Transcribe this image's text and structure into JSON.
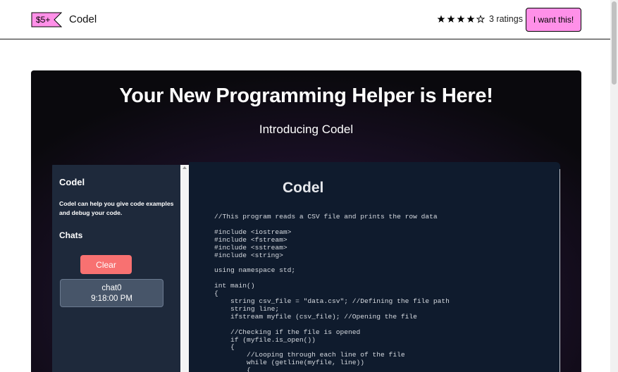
{
  "header": {
    "price": "$5+",
    "product_name": "Codel",
    "rating_stars": 4,
    "rating_max": 5,
    "ratings_text": "3 ratings",
    "cta_label": "I want this!"
  },
  "hero": {
    "title": "Your New Programming Helper is Here!",
    "subtitle": "Introducing Codel"
  },
  "app": {
    "sidebar": {
      "title": "Codel",
      "description": "Codel can help you give code examples and debug your code.",
      "chats_heading": "Chats",
      "clear_label": "Clear",
      "chat_name": "chat0",
      "chat_time": "9:18:00 PM"
    },
    "main": {
      "title": "Codel",
      "code": "//This program reads a CSV file and prints the row data\n\n#include <iostream>\n#include <fstream>\n#include <sstream>\n#include <string>\n\nusing namespace std;\n\nint main()\n{\n    string csv_file = \"data.csv\"; //Defining the file path\n    string line;\n    ifstream myfile (csv_file); //Opening the file\n\n    //Checking if the file is opened\n    if (myfile.is_open())\n    {\n        //Looping through each line of the file\n        while (getline(myfile, line))\n        {"
    }
  },
  "colors": {
    "accent_pink": "#ff90e8",
    "clear_red": "#f87171",
    "sidebar_bg": "#1e293b",
    "main_bg": "#0f1b2d"
  }
}
